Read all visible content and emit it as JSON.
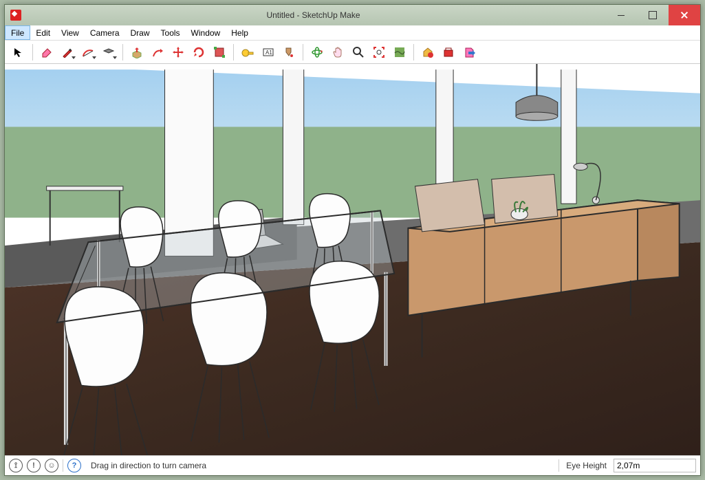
{
  "title": "Untitled - SketchUp Make",
  "menu": {
    "file": "File",
    "edit": "Edit",
    "view": "View",
    "camera": "Camera",
    "draw": "Draw",
    "tools": "Tools",
    "window": "Window",
    "help": "Help"
  },
  "tools": {
    "select": "select",
    "eraser": "eraser",
    "pencil": "pencil",
    "arc": "arc",
    "rectangle": "rectangle",
    "pushpull": "pushpull",
    "followme": "followme",
    "move": "move",
    "rotate": "rotate",
    "scale": "scale",
    "tape": "tape",
    "dimension": "dimension",
    "paint": "paint",
    "orbit": "orbit",
    "pan": "pan",
    "zoom": "zoom",
    "zoomextents": "zoomextents",
    "addlocation": "addlocation",
    "warehouse": "warehouse",
    "extensions": "extensions",
    "export": "export"
  },
  "status": {
    "hint": "Drag in direction to turn camera",
    "eye_label": "Eye Height",
    "eye_value": "2,07m"
  }
}
